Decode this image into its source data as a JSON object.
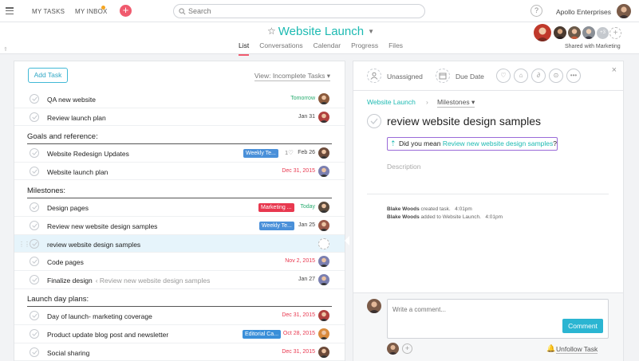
{
  "topbar": {
    "my_tasks": "MY TASKS",
    "my_inbox": "MY INBOX",
    "search_placeholder": "Search",
    "help": "?",
    "org": "Apollo Enterprises"
  },
  "project": {
    "title": "Website Launch",
    "tabs": [
      {
        "label": "List",
        "active": true
      },
      {
        "label": "Conversations"
      },
      {
        "label": "Calendar"
      },
      {
        "label": "Progress"
      },
      {
        "label": "Files"
      }
    ],
    "more_members": "+3",
    "shared_with": "Shared with Marketing"
  },
  "list": {
    "add_task": "Add Task",
    "view": "View: Incomplete Tasks"
  },
  "tasks": [
    {
      "kind": "task",
      "name": "QA new website",
      "due": "Tomorrow",
      "due_color": "green",
      "avatar": "#8a5a3c"
    },
    {
      "kind": "task",
      "name": "Review launch plan",
      "due": "Jan 31",
      "due_color": "grey",
      "avatar": "#b0413e"
    },
    {
      "kind": "section",
      "name": "Goals and reference:"
    },
    {
      "kind": "task",
      "name": "Website Redesign Updates",
      "tag": "Weekly Te...",
      "tag_color": "#4a90d9",
      "likes": "1",
      "due": "Feb 26",
      "due_color": "grey",
      "avatar": "#6b4a3a"
    },
    {
      "kind": "task",
      "name": "Website launch plan",
      "due": "Dec 31, 2015",
      "due_color": "red",
      "avatar": "#7a7fb0"
    },
    {
      "kind": "section",
      "name": "Milestones:"
    },
    {
      "kind": "task",
      "name": "Design pages",
      "tag": "Marketing ...",
      "tag_color": "#e8384f",
      "due": "Today",
      "due_color": "green",
      "avatar": "#5a4a3c"
    },
    {
      "kind": "task",
      "name": "Review new website design samples",
      "tag": "Weekly Te...",
      "tag_color": "#4a90d9",
      "due": "Jan 25",
      "due_color": "grey",
      "avatar": "#9a5a4a"
    },
    {
      "kind": "task",
      "name": "review website design samples",
      "selected": true,
      "avatar": ""
    },
    {
      "kind": "task",
      "name": "Code pages",
      "due": "Nov 2, 2015",
      "due_color": "red",
      "avatar": "#7a7fb0"
    },
    {
      "kind": "task",
      "name": "Finalize design",
      "sub": "‹ Review new website design samples",
      "due": "Jan 27",
      "due_color": "grey",
      "avatar": "#7a7fb0"
    },
    {
      "kind": "section",
      "name": "Launch day plans:"
    },
    {
      "kind": "task",
      "name": "Day of launch- marketing coverage",
      "due": "Dec 31, 2015",
      "due_color": "red",
      "avatar": "#b0413e"
    },
    {
      "kind": "task",
      "name": "Product update blog post and newsletter",
      "tag": "Editorial Ca...",
      "tag_color": "#3a8fd9",
      "due": "Oct 28, 2015",
      "due_color": "red",
      "avatar": "#d98a3c"
    },
    {
      "kind": "task",
      "name": "Social sharing",
      "due": "Dec 31, 2015",
      "due_color": "red",
      "avatar": "#6b4a3a"
    }
  ],
  "detail": {
    "unassigned": "Unassigned",
    "due_date": "Due Date",
    "breadcrumb_project": "Website Launch",
    "breadcrumb_sep": "›",
    "breadcrumb_milestone": "Milestones",
    "title": "review website design samples",
    "suggestion_prefix": "Did you mean ",
    "suggestion_link": "Review new website design samples",
    "suggestion_suffix": "?",
    "description_placeholder": "Description",
    "activity": [
      {
        "user": "Blake Woods",
        "text": " created task.",
        "time": "4:01pm"
      },
      {
        "user": "Blake Woods",
        "text": " added to Website Launch.",
        "time": "4:01pm"
      }
    ],
    "comment_placeholder": "Write a comment...",
    "comment_button": "Comment",
    "unfollow": "Unfollow Task",
    "close": "×"
  }
}
